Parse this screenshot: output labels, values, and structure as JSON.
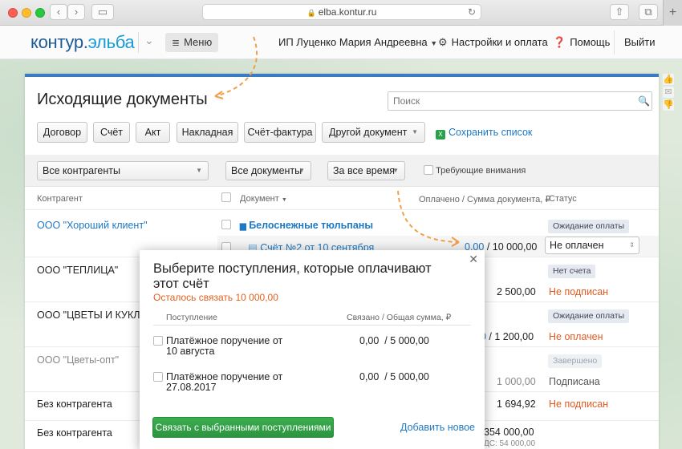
{
  "browser": {
    "url": "elba.kontur.ru"
  },
  "appbar": {
    "logo_main": "контур.",
    "logo_accent": "эльба",
    "menu_label": "Меню",
    "user_name": "ИП Луценко Мария Андреевна",
    "settings_label": "Настройки и оплата",
    "help_label": "Помощь",
    "logout_label": "Выйти"
  },
  "page": {
    "title": "Исходящие документы",
    "search_placeholder": "Поиск"
  },
  "toolbar": {
    "buttons": [
      "Договор",
      "Счёт",
      "Акт",
      "Накладная",
      "Счёт-фактура",
      "Другой документ"
    ],
    "save_list": "Сохранить список"
  },
  "filters": {
    "counterparty": "Все контрагенты",
    "documents": "Все документы",
    "period": "За все время",
    "attention_label": "Требующие внимания"
  },
  "table": {
    "headers": {
      "counterparty": "Контрагент",
      "document": "Документ",
      "amount": "Оплачено / Сумма документа, ₽",
      "status": "Статус"
    },
    "rows": [
      {
        "counterparty": "ООО \"Хороший клиент\"",
        "document": "Белоснежные тюльпаны",
        "status": "Ожидание оплаты"
      },
      {
        "document": "Счёт №2 от 10 сентября",
        "paid": "0,00",
        "total": " / 10 000,00",
        "status": "Не оплачен"
      },
      {
        "counterparty": "ООО \"ТЕПЛИЦА\"",
        "status_badge": "Нет счета",
        "amount": "2 500,00",
        "status": "Не подписан"
      },
      {
        "counterparty": "ООО \"ЦВЕТЫ И КУКЛЫ\"",
        "status_badge": "Ожидание оплаты",
        "amount_partial": "0",
        "amount": " / 1 200,00",
        "status": "Не оплачен"
      },
      {
        "counterparty": "ООО \"Цветы-опт\"",
        "status_badge": "Завершено",
        "amount": "1 000,00",
        "status": "Подписана"
      },
      {
        "counterparty": "Без контрагента",
        "amount": "1 694,92",
        "status": "Не подписан"
      },
      {
        "counterparty": "Без контрагента",
        "amount": "354 000,00",
        "vat": "ДС: 54 000,00"
      }
    ]
  },
  "modal": {
    "title": "Выберите поступления, которые оплачивают этот счёт",
    "remaining": "Осталось связать 10 000,00",
    "col_income": "Поступление",
    "col_linked": "Связано",
    "col_total": " / Общая сумма, ₽",
    "items": [
      {
        "label": "Платёжное поручение от 10 августа",
        "amount": "0,00  / 5 000,00"
      },
      {
        "label": "Платёжное поручение от 27.08.2017",
        "amount": "0,00  / 5 000,00"
      }
    ],
    "link_button": "Связать с выбранными поступлениями",
    "add_new": "Добавить новое"
  },
  "colors": {
    "accent_blue": "#1e78c2",
    "warning_orange": "#e35a20",
    "success_green": "#2c9440"
  }
}
